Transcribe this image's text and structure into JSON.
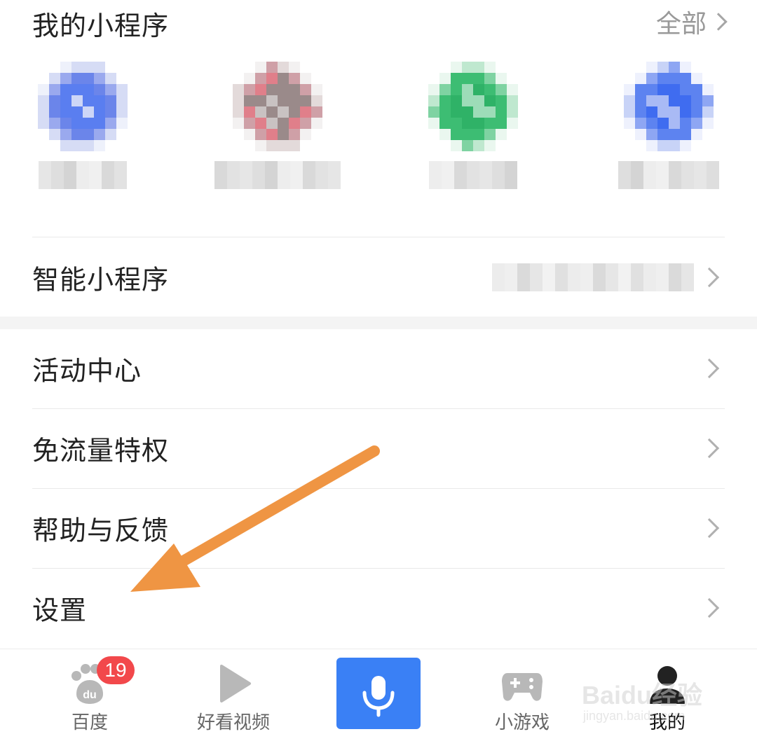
{
  "mini_programs": {
    "title": "我的小程序",
    "all_label": "全部"
  },
  "apps": [
    {
      "icon": "blurred-app-icon-blue",
      "name": ""
    },
    {
      "icon": "blurred-app-icon-red-gray",
      "name": ""
    },
    {
      "icon": "blurred-app-icon-green",
      "name": ""
    },
    {
      "icon": "blurred-app-icon-blue-globe",
      "name": ""
    }
  ],
  "smart_row": {
    "label": "智能小程序",
    "value": ""
  },
  "menu": [
    {
      "label": "活动中心"
    },
    {
      "label": "免流量特权"
    },
    {
      "label": "帮助与反馈"
    },
    {
      "label": "设置"
    }
  ],
  "tabbar": {
    "baidu": {
      "label": "百度",
      "badge": "19",
      "icon": "baidu-paw-icon"
    },
    "video": {
      "label": "好看视频",
      "icon": "play-icon"
    },
    "voice": {
      "icon": "microphone-icon"
    },
    "games": {
      "label": "小游戏",
      "icon": "gamepad-icon"
    },
    "mine": {
      "label": "我的",
      "icon": "person-icon"
    }
  },
  "watermark": {
    "brand": "Baidu经验",
    "sub": "jingyan.baidu.com"
  },
  "colors": {
    "accent_blue": "#3a80f5",
    "badge_red": "#f2484b",
    "arrow_orange": "#ef9543"
  }
}
